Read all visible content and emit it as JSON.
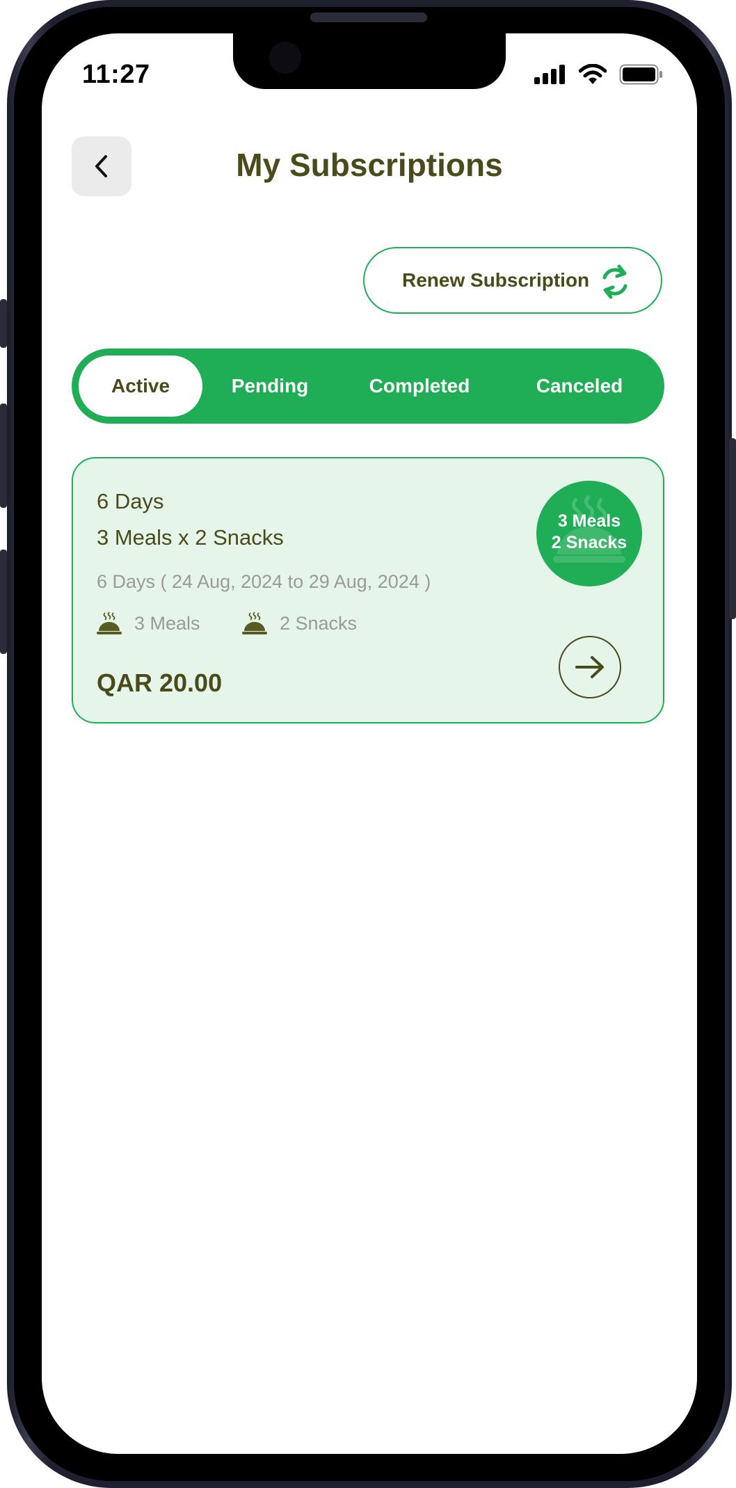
{
  "status_bar": {
    "time": "11:27"
  },
  "header": {
    "title": "My Subscriptions",
    "back_icon": "chevron-left-icon"
  },
  "renew_button": {
    "label": "Renew Subscription",
    "icon": "refresh-icon"
  },
  "tabs": [
    {
      "label": "Active",
      "selected": true
    },
    {
      "label": "Pending",
      "selected": false
    },
    {
      "label": "Completed",
      "selected": false
    },
    {
      "label": "Canceled",
      "selected": false
    }
  ],
  "subscription_card": {
    "days": "6 Days",
    "plan": "3 Meals x 2 Snacks",
    "date_range": "6 Days ( 24 Aug, 2024 to 29 Aug, 2024 )",
    "meals": "3 Meals",
    "snacks": "2 Snacks",
    "price": "QAR 20.00",
    "badge": {
      "line1": "3 Meals",
      "line2": "2 Snacks"
    },
    "meal_icon": "cloche-icon",
    "arrow_icon": "arrow-right-icon"
  },
  "colors": {
    "accent": "#1fae56",
    "text_dark": "#4a4a1a",
    "card_bg": "#e6f5ea",
    "muted": "#9a9a9a"
  }
}
